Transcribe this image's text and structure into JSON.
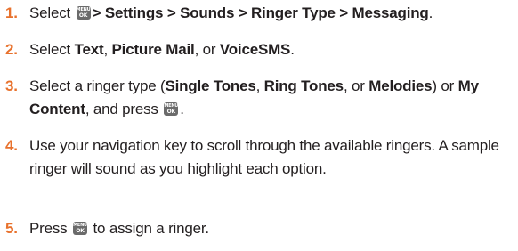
{
  "menu_key": {
    "line1": "MENU",
    "line2": "OK",
    "icon": "menu-ok-key-icon"
  },
  "accent_color": "#e8712c",
  "steps": [
    {
      "number": "1.",
      "pre": "Select",
      "path": "> Settings > Sounds > Ringer Type > Messaging",
      "post": "."
    },
    {
      "number": "2.",
      "pre": "Select ",
      "opt1": "Text",
      "sep1": ", ",
      "opt2": "Picture Mail",
      "sep2": ", or ",
      "opt3": "VoiceSMS",
      "post": "."
    },
    {
      "number": "3.",
      "pre": "Select a ringer type (",
      "opt1": "Single Tones",
      "sep1": ", ",
      "opt2": "Ring Tones",
      "sep2": ", or ",
      "opt3": "Melodies",
      "sep3": ") or ",
      "opt4": "My Content",
      "sep4": ", and press",
      "post": "."
    },
    {
      "number": "4.",
      "text": "Use your navigation key to scroll through the available ringers. A sample ringer will sound as you highlight each option."
    },
    {
      "number": "5.",
      "pre": "Press",
      "post": "to assign a ringer."
    }
  ]
}
